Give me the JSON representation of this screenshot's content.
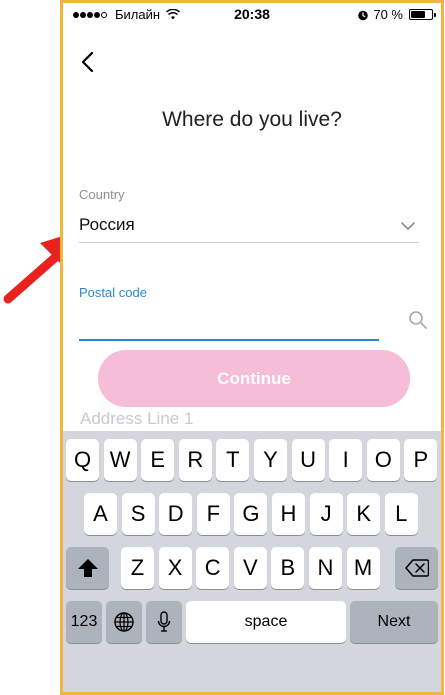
{
  "status_bar": {
    "carrier": "Билайн",
    "time": "20:38",
    "battery_text": "70 %",
    "battery_level": 0.7
  },
  "icons": {
    "back": "chevron-left-icon",
    "wifi": "wifi-icon",
    "alarm": "alarm-icon",
    "battery": "battery-icon",
    "dropdown": "chevron-down-icon",
    "search": "search-icon",
    "shift": "shift-icon",
    "backspace": "backspace-icon",
    "globe": "globe-icon",
    "mic": "microphone-icon",
    "annotation": "red-arrow-icon"
  },
  "page": {
    "title": "Where do you live?"
  },
  "form": {
    "country_label": "Country",
    "country_value": "Россия",
    "postal_label": "Postal code",
    "postal_value": "",
    "continue_label": "Continue",
    "address_line_placeholder": "Address Line 1"
  },
  "keyboard": {
    "row1": [
      "Q",
      "W",
      "E",
      "R",
      "T",
      "Y",
      "U",
      "I",
      "O",
      "P"
    ],
    "row2": [
      "A",
      "S",
      "D",
      "F",
      "G",
      "H",
      "J",
      "K",
      "L"
    ],
    "row3": [
      "Z",
      "X",
      "C",
      "V",
      "B",
      "N",
      "M"
    ],
    "numbers_label": "123",
    "space_label": "space",
    "return_label": "Next"
  },
  "colors": {
    "frame_border": "#f2b640",
    "accent_blue": "#2a87d0",
    "continue_bg": "#f6bdd9",
    "keyboard_bg": "#d3d6dc",
    "annotation_red": "#e8231f"
  }
}
